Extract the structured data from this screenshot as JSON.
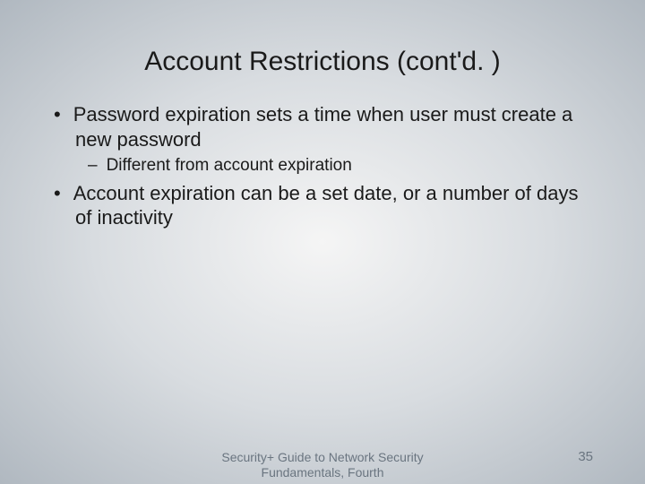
{
  "slide": {
    "title": "Account Restrictions (cont'd. )",
    "bullets": [
      {
        "level": 1,
        "text": "Password expiration sets a time when user must create a new password"
      },
      {
        "level": 2,
        "text": "Different from account expiration"
      },
      {
        "level": 1,
        "text": "Account expiration can be a set date, or a number of days of inactivity"
      }
    ],
    "footer": "Security+ Guide to Network Security Fundamentals, Fourth",
    "page_number": "35"
  }
}
